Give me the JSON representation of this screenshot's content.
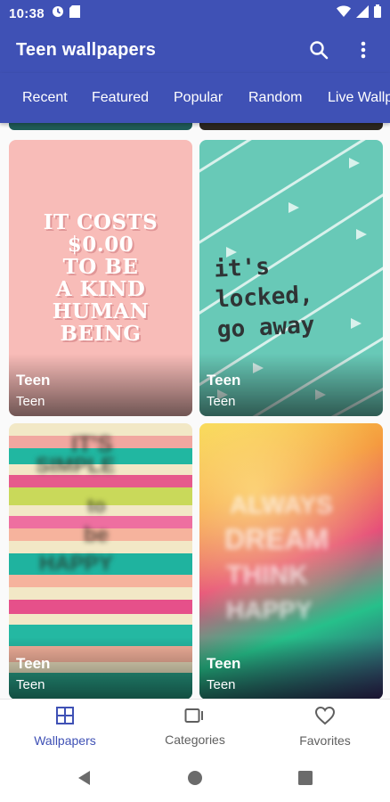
{
  "status_bar": {
    "time": "10:38",
    "left_icons": [
      "data-saver-icon",
      "sd-card-icon"
    ],
    "right_icons": [
      "wifi-icon",
      "signal-icon",
      "battery-icon"
    ]
  },
  "app_bar": {
    "title": "Teen wallpapers",
    "actions": [
      "search-icon",
      "more-vert-icon"
    ],
    "background": "#3f51b5"
  },
  "tabs": [
    {
      "label": "Recent"
    },
    {
      "label": "Featured"
    },
    {
      "label": "Popular"
    },
    {
      "label": "Random"
    },
    {
      "label": "Live Wallp"
    }
  ],
  "wallpapers": [
    {
      "title": "Teen",
      "category": "Teen",
      "quote": [
        "IT COSTS",
        "$0.00",
        "TO BE",
        "A KIND",
        "HUMAN",
        "BEING"
      ]
    },
    {
      "title": "Teen",
      "category": "Teen",
      "quote": [
        "it's locked,",
        "go away"
      ]
    },
    {
      "title": "Teen",
      "category": "Teen"
    },
    {
      "title": "Teen",
      "category": "Teen"
    }
  ],
  "bottom_nav": [
    {
      "label": "Wallpapers",
      "icon": "grid-icon",
      "active": true
    },
    {
      "label": "Categories",
      "icon": "categories-icon",
      "active": false
    },
    {
      "label": "Favorites",
      "icon": "heart-icon",
      "active": false
    }
  ],
  "system_nav": [
    "back-icon",
    "home-icon",
    "recents-icon"
  ],
  "colors": {
    "primary": "#3f51b5",
    "inactive": "#5f5f5f"
  }
}
